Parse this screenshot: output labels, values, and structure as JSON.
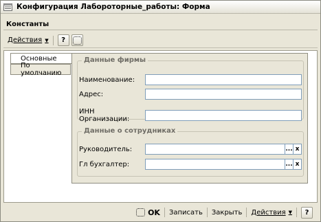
{
  "window": {
    "title": "Конфигурация Лабороторные_работы: Форма"
  },
  "form": {
    "header": "Константы"
  },
  "toolbar": {
    "actions_label": "Действия",
    "help_label": "?"
  },
  "tabs": [
    {
      "label": "Основные",
      "active": true
    },
    {
      "label": "По умолчанию",
      "active": false
    }
  ],
  "groups": {
    "company": {
      "title": "Данные фирмы",
      "fields": [
        {
          "label": "Наименование:",
          "value": ""
        },
        {
          "label": "Адрес:",
          "value": ""
        },
        {
          "label": "ИНН Организации:",
          "value": ""
        }
      ]
    },
    "staff": {
      "title": "Данные о сотрудниках",
      "fields": [
        {
          "label": "Руководитель:",
          "value": "",
          "select_label": "...",
          "clear_label": "x"
        },
        {
          "label": "Гл бухгалтер:",
          "value": "",
          "select_label": "...",
          "clear_label": "x"
        }
      ]
    }
  },
  "footer": {
    "ok_label": "OK",
    "save_label": "Записать",
    "close_label": "Закрыть",
    "actions_label": "Действия",
    "help_label": "?"
  }
}
